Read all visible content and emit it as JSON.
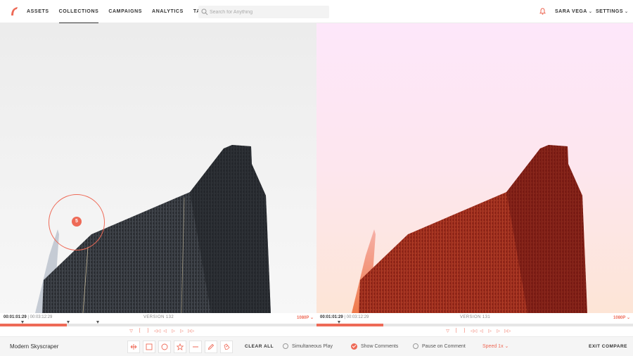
{
  "nav": {
    "items": [
      "ASSETS",
      "COLLECTIONS",
      "CAMPAIGNS",
      "ANALYTICS",
      "TASKS"
    ],
    "active": "COLLECTIONS"
  },
  "search": {
    "placeholder": "Search for Anything"
  },
  "user": {
    "name": "SARA VEGA"
  },
  "settings": {
    "label": "SETTINGS"
  },
  "icons": {
    "logo": "brand-logo-icon",
    "search": "search-icon",
    "notification": "bell-icon",
    "chevron": "chevron-down-icon"
  },
  "colors": {
    "accent": "#ee6a57"
  },
  "viewers": [
    {
      "current_time": "00:01:01:29",
      "total_time": "00:03:12:29",
      "version": "VERSION 132",
      "resolution": "1080P",
      "progress": 0.21
    },
    {
      "current_time": "00:01:01:29",
      "total_time": "00:03:12:29",
      "version": "VERSION 131",
      "resolution": "1080P",
      "progress": 0.21
    }
  ],
  "comment": {
    "number": "5"
  },
  "playback_controls": [
    "playback-marker-icon",
    "bracket-in-icon",
    "bracket-out-icon",
    "step-back-icon",
    "frame-back-icon",
    "play-icon",
    "frame-forward-icon",
    "step-forward-icon"
  ],
  "toolbar": {
    "asset_name": "Modern Skyscraper",
    "tools": [
      "move-icon",
      "rectangle-icon",
      "circle-icon",
      "star-icon",
      "line-icon",
      "pen-icon",
      "eraser-icon"
    ],
    "clear_label": "CLEAR ALL",
    "simultaneous_play": {
      "label": "Simultaneous Play",
      "checked": false
    },
    "show_comments": {
      "label": "Show Comments",
      "checked": true
    },
    "pause_on_comment": {
      "label": "Pause on Comment",
      "checked": false
    },
    "speed_label": "Speed 1x",
    "exit_label": "EXIT COMPARE"
  }
}
